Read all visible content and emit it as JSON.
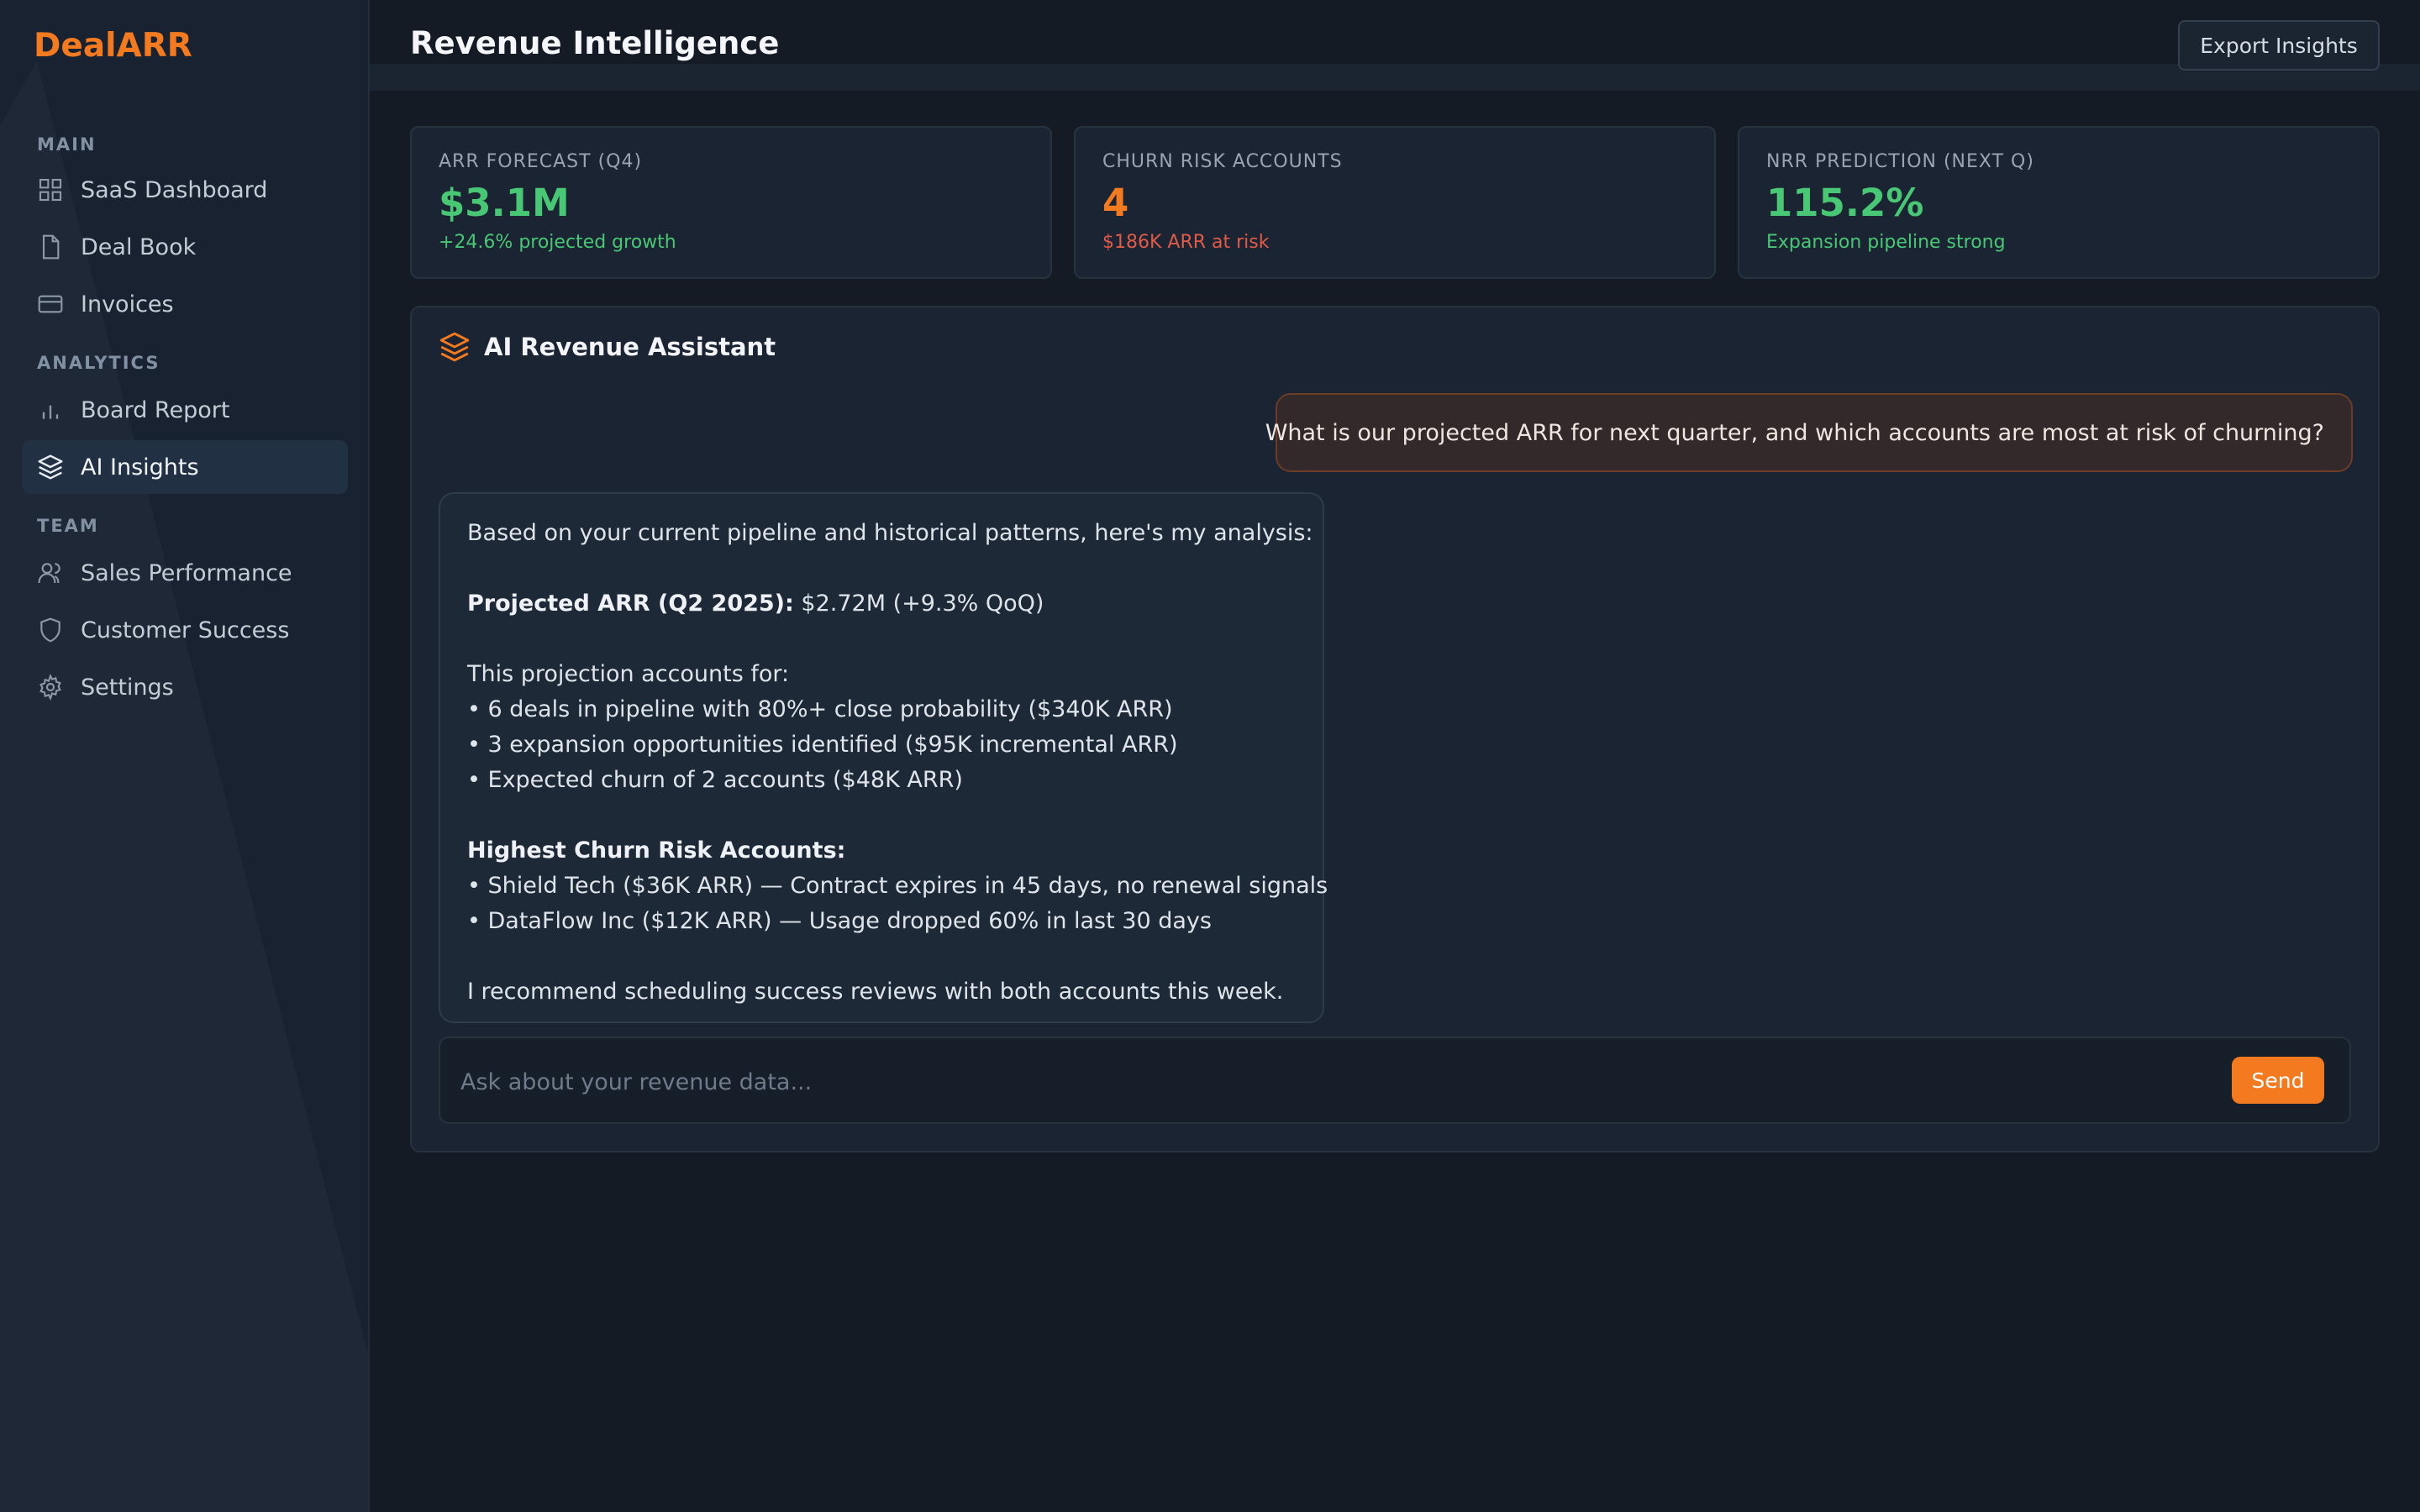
{
  "brand": {
    "name": "DealARR"
  },
  "sidebar": {
    "sections": [
      {
        "title": "MAIN"
      },
      {
        "title": "ANALYTICS"
      },
      {
        "title": "TEAM"
      }
    ],
    "items": [
      {
        "label": "SaaS Dashboard",
        "icon": "grid-icon"
      },
      {
        "label": "Deal Book",
        "icon": "document-icon"
      },
      {
        "label": "Invoices",
        "icon": "credit-card-icon"
      },
      {
        "label": "Board Report",
        "icon": "bar-chart-icon"
      },
      {
        "label": "AI Insights",
        "icon": "layers-icon",
        "active": true
      },
      {
        "label": "Sales Performance",
        "icon": "users-icon"
      },
      {
        "label": "Customer Success",
        "icon": "shield-icon"
      },
      {
        "label": "Settings",
        "icon": "gear-icon"
      }
    ]
  },
  "header": {
    "title": "Revenue Intelligence",
    "export_label": "Export Insights"
  },
  "kpis": [
    {
      "label": "ARR FORECAST (Q4)",
      "value": "$3.1M",
      "sub": "+24.6% projected growth"
    },
    {
      "label": "CHURN RISK ACCOUNTS",
      "value": "4",
      "sub": "$186K ARR at risk"
    },
    {
      "label": "NRR PREDICTION (NEXT Q)",
      "value": "115.2%",
      "sub": "Expansion pipeline strong"
    }
  ],
  "assistant": {
    "title": "AI Revenue Assistant",
    "user_message": "What is our projected ARR for next quarter, and which accounts are most at risk of churning?",
    "response": {
      "intro": "Based on your current pipeline and historical patterns, here's my analysis:",
      "projection_label": "Projected ARR (Q2 2025):",
      "projection_value": " $2.72M (+9.3% QoQ)",
      "accounts_for": "This projection accounts for:",
      "bullets": [
        "• 6 deals in pipeline with 80%+ close probability ($340K ARR)",
        "• 3 expansion opportunities identified ($95K incremental ARR)",
        "• Expected churn of 2 accounts ($48K ARR)"
      ],
      "risk_heading": "Highest Churn Risk Accounts:",
      "risk_bullets": [
        "• Shield Tech ($36K ARR) — Contract expires in 45 days, no renewal signals",
        "• DataFlow Inc ($12K ARR) — Usage dropped 60% in last 30 days"
      ],
      "recommendation": "I recommend scheduling success reviews with both accounts this week."
    },
    "input_placeholder": "Ask about your revenue data...",
    "send_label": "Send"
  },
  "colors": {
    "accent": "#f47a20",
    "positive": "#48c774",
    "negative": "#e05a48",
    "background": "#141b25",
    "sidebar": "#182230"
  }
}
